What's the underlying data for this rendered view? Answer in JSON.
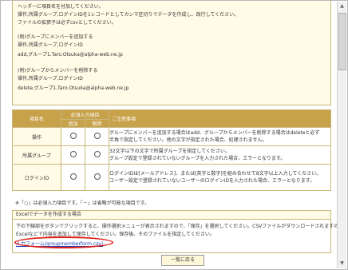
{
  "instructions": {
    "lines": [
      "ヘッダーに項目名を付加してください。",
      "操作,所属グループ,ログインIDを1レコードとしてカンマ区切りでデータを作成し、改行してください。",
      "ファイルの拡張子は必ずcsvとしてください。",
      "(例)グループにメンバーを追加する",
      "操作,所属グループ,ログインID",
      "add,グループ1,Taro.Otsuka@alpha-web.ne.jp",
      "(例)グループからメンバーを削除する",
      "操作,所属グループ,ログインID",
      "delete,グループ1,Taro.Otsuka@alpha-web.ne.jp"
    ]
  },
  "table": {
    "headers": {
      "item": "項目名",
      "required": "必須入力項目",
      "add": "追加",
      "delete": "削除",
      "notes": "ご注意事項"
    },
    "rows": [
      {
        "name": "操作",
        "note1": "グループにメンバーを追加する場合はadd、グループからメンバーを削除する場合はdeleteと必ず",
        "note2": "半角で指定してください。他の文字が指定された場合、処理されません。"
      },
      {
        "name": "所属グループ",
        "note1": "32文字以下の文字で所属グループを指定してください。",
        "note2": "グループ設定で登録されていないグループを入力された場合、エラーとなります。"
      },
      {
        "name": "ログインID",
        "note1": "ログインIDは[メールアドレス]、または[英字と数字]を組み合わせて8文字以上入力してください。",
        "note2": "ユーザー設定で登録されていないユーザーのログインIDを入力された場合、エラーとなります。"
      }
    ]
  },
  "legend": "※「○」は必須入力項目です。「－」は省略が可能な項目です。",
  "excel": {
    "title": "Excelでデータを作成する場合",
    "line1": "下の下線部をボタンでクリックすると、操作選択メニューが表示されますので、「保存」を選択してください。CSVファイルがダウンロードされますので、",
    "line2": "Excelなどで内容を追加して保存してください。保存後、そのファイルを指定してください。",
    "link": "入力フォーム(groupmemberform.csv)"
  },
  "back_button": "一覧に戻る"
}
